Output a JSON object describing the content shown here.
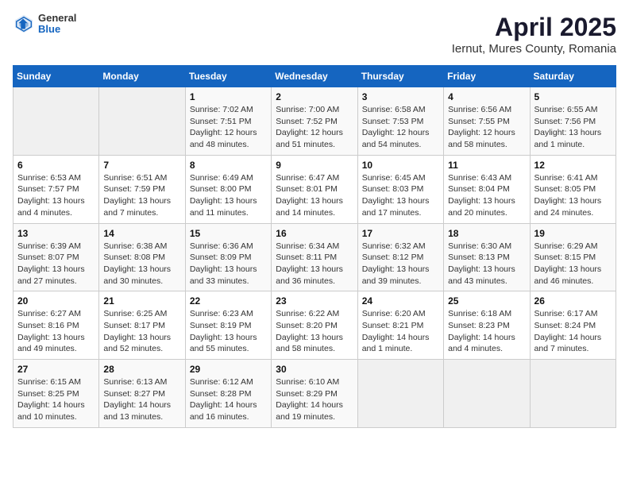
{
  "header": {
    "logo_general": "General",
    "logo_blue": "Blue",
    "title": "April 2025",
    "subtitle": "Iernut, Mures County, Romania"
  },
  "calendar": {
    "days_of_week": [
      "Sunday",
      "Monday",
      "Tuesday",
      "Wednesday",
      "Thursday",
      "Friday",
      "Saturday"
    ],
    "weeks": [
      [
        {
          "day": "",
          "info": ""
        },
        {
          "day": "",
          "info": ""
        },
        {
          "day": "1",
          "info": "Sunrise: 7:02 AM\nSunset: 7:51 PM\nDaylight: 12 hours\nand 48 minutes."
        },
        {
          "day": "2",
          "info": "Sunrise: 7:00 AM\nSunset: 7:52 PM\nDaylight: 12 hours\nand 51 minutes."
        },
        {
          "day": "3",
          "info": "Sunrise: 6:58 AM\nSunset: 7:53 PM\nDaylight: 12 hours\nand 54 minutes."
        },
        {
          "day": "4",
          "info": "Sunrise: 6:56 AM\nSunset: 7:55 PM\nDaylight: 12 hours\nand 58 minutes."
        },
        {
          "day": "5",
          "info": "Sunrise: 6:55 AM\nSunset: 7:56 PM\nDaylight: 13 hours\nand 1 minute."
        }
      ],
      [
        {
          "day": "6",
          "info": "Sunrise: 6:53 AM\nSunset: 7:57 PM\nDaylight: 13 hours\nand 4 minutes."
        },
        {
          "day": "7",
          "info": "Sunrise: 6:51 AM\nSunset: 7:59 PM\nDaylight: 13 hours\nand 7 minutes."
        },
        {
          "day": "8",
          "info": "Sunrise: 6:49 AM\nSunset: 8:00 PM\nDaylight: 13 hours\nand 11 minutes."
        },
        {
          "day": "9",
          "info": "Sunrise: 6:47 AM\nSunset: 8:01 PM\nDaylight: 13 hours\nand 14 minutes."
        },
        {
          "day": "10",
          "info": "Sunrise: 6:45 AM\nSunset: 8:03 PM\nDaylight: 13 hours\nand 17 minutes."
        },
        {
          "day": "11",
          "info": "Sunrise: 6:43 AM\nSunset: 8:04 PM\nDaylight: 13 hours\nand 20 minutes."
        },
        {
          "day": "12",
          "info": "Sunrise: 6:41 AM\nSunset: 8:05 PM\nDaylight: 13 hours\nand 24 minutes."
        }
      ],
      [
        {
          "day": "13",
          "info": "Sunrise: 6:39 AM\nSunset: 8:07 PM\nDaylight: 13 hours\nand 27 minutes."
        },
        {
          "day": "14",
          "info": "Sunrise: 6:38 AM\nSunset: 8:08 PM\nDaylight: 13 hours\nand 30 minutes."
        },
        {
          "day": "15",
          "info": "Sunrise: 6:36 AM\nSunset: 8:09 PM\nDaylight: 13 hours\nand 33 minutes."
        },
        {
          "day": "16",
          "info": "Sunrise: 6:34 AM\nSunset: 8:11 PM\nDaylight: 13 hours\nand 36 minutes."
        },
        {
          "day": "17",
          "info": "Sunrise: 6:32 AM\nSunset: 8:12 PM\nDaylight: 13 hours\nand 39 minutes."
        },
        {
          "day": "18",
          "info": "Sunrise: 6:30 AM\nSunset: 8:13 PM\nDaylight: 13 hours\nand 43 minutes."
        },
        {
          "day": "19",
          "info": "Sunrise: 6:29 AM\nSunset: 8:15 PM\nDaylight: 13 hours\nand 46 minutes."
        }
      ],
      [
        {
          "day": "20",
          "info": "Sunrise: 6:27 AM\nSunset: 8:16 PM\nDaylight: 13 hours\nand 49 minutes."
        },
        {
          "day": "21",
          "info": "Sunrise: 6:25 AM\nSunset: 8:17 PM\nDaylight: 13 hours\nand 52 minutes."
        },
        {
          "day": "22",
          "info": "Sunrise: 6:23 AM\nSunset: 8:19 PM\nDaylight: 13 hours\nand 55 minutes."
        },
        {
          "day": "23",
          "info": "Sunrise: 6:22 AM\nSunset: 8:20 PM\nDaylight: 13 hours\nand 58 minutes."
        },
        {
          "day": "24",
          "info": "Sunrise: 6:20 AM\nSunset: 8:21 PM\nDaylight: 14 hours\nand 1 minute."
        },
        {
          "day": "25",
          "info": "Sunrise: 6:18 AM\nSunset: 8:23 PM\nDaylight: 14 hours\nand 4 minutes."
        },
        {
          "day": "26",
          "info": "Sunrise: 6:17 AM\nSunset: 8:24 PM\nDaylight: 14 hours\nand 7 minutes."
        }
      ],
      [
        {
          "day": "27",
          "info": "Sunrise: 6:15 AM\nSunset: 8:25 PM\nDaylight: 14 hours\nand 10 minutes."
        },
        {
          "day": "28",
          "info": "Sunrise: 6:13 AM\nSunset: 8:27 PM\nDaylight: 14 hours\nand 13 minutes."
        },
        {
          "day": "29",
          "info": "Sunrise: 6:12 AM\nSunset: 8:28 PM\nDaylight: 14 hours\nand 16 minutes."
        },
        {
          "day": "30",
          "info": "Sunrise: 6:10 AM\nSunset: 8:29 PM\nDaylight: 14 hours\nand 19 minutes."
        },
        {
          "day": "",
          "info": ""
        },
        {
          "day": "",
          "info": ""
        },
        {
          "day": "",
          "info": ""
        }
      ]
    ]
  }
}
